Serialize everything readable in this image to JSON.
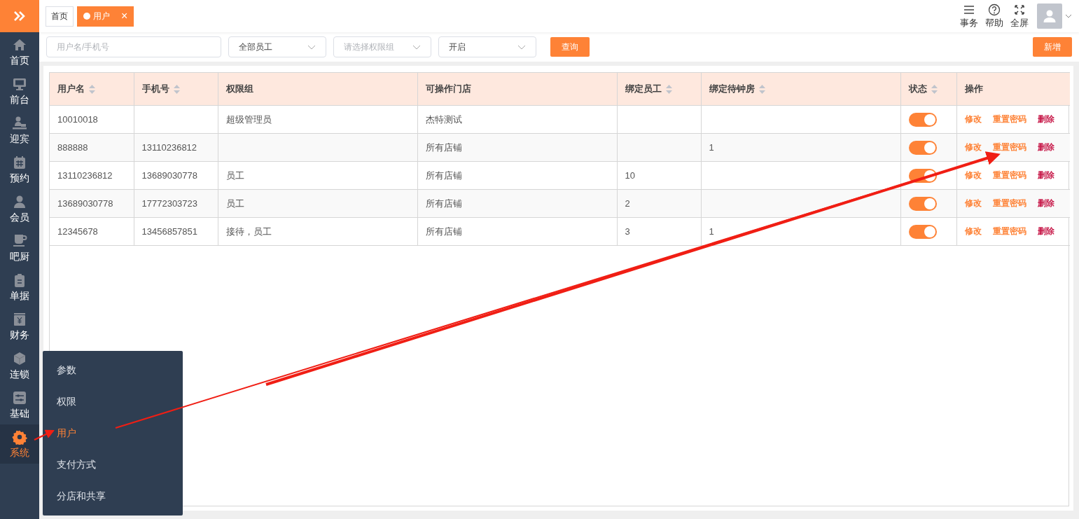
{
  "sidebar": {
    "items": [
      {
        "label": "首页",
        "selected": false
      },
      {
        "label": "前台",
        "selected": false
      },
      {
        "label": "迎宾",
        "selected": false
      },
      {
        "label": "预约",
        "selected": false
      },
      {
        "label": "会员",
        "selected": false
      },
      {
        "label": "吧厨",
        "selected": false
      },
      {
        "label": "单据",
        "selected": false
      },
      {
        "label": "财务",
        "selected": false
      },
      {
        "label": "连锁",
        "selected": false
      },
      {
        "label": "基础",
        "selected": false
      },
      {
        "label": "系统",
        "selected": true
      }
    ]
  },
  "tabs": [
    {
      "label": "首页",
      "selected": false,
      "closable": false
    },
    {
      "label": "用户",
      "selected": true,
      "closable": true
    }
  ],
  "close_glyph": "×",
  "header_actions": [
    {
      "label": "事务"
    },
    {
      "label": "帮助"
    },
    {
      "label": "全屏"
    }
  ],
  "filters": {
    "search": {
      "placeholder": "用户名/手机号"
    },
    "staff": {
      "value": "全部员工"
    },
    "group": {
      "placeholder": "请选择权限组"
    },
    "state": {
      "value": "开启"
    },
    "query_button": "查询",
    "add_button": "新增"
  },
  "table": {
    "columns": [
      {
        "label": "用户名",
        "sortable": true
      },
      {
        "label": "手机号",
        "sortable": true
      },
      {
        "label": "权限组",
        "sortable": false
      },
      {
        "label": "可操作门店",
        "sortable": false
      },
      {
        "label": "绑定员工",
        "sortable": true
      },
      {
        "label": "绑定待钟房",
        "sortable": true
      },
      {
        "label": "状态",
        "sortable": true
      },
      {
        "label": "操作",
        "sortable": false
      }
    ],
    "rows": [
      {
        "cells": [
          "10010018",
          "",
          "超级管理员",
          "杰特测试",
          "",
          ""
        ],
        "on": true,
        "actions": [
          {
            "kind": "edit",
            "label": "修改"
          },
          {
            "kind": "reset",
            "label": "重置密码"
          },
          {
            "kind": "delete",
            "label": "删除"
          }
        ]
      },
      {
        "cells": [
          "888888",
          "13110236812",
          "",
          "所有店铺",
          "",
          "1"
        ],
        "on": true,
        "actions": [
          {
            "kind": "edit",
            "label": "修改"
          },
          {
            "kind": "reset",
            "label": "重置密码"
          },
          {
            "kind": "delete",
            "label": "删除"
          }
        ]
      },
      {
        "cells": [
          "13110236812",
          "13689030778",
          "员工",
          "所有店铺",
          "10",
          ""
        ],
        "on": true,
        "actions": [
          {
            "kind": "edit",
            "label": "修改"
          },
          {
            "kind": "reset",
            "label": "重置密码"
          },
          {
            "kind": "delete",
            "label": "删除"
          }
        ]
      },
      {
        "cells": [
          "13689030778",
          "17772303723",
          "员工",
          "所有店铺",
          "2",
          ""
        ],
        "on": true,
        "actions": [
          {
            "kind": "edit",
            "label": "修改"
          },
          {
            "kind": "reset",
            "label": "重置密码"
          },
          {
            "kind": "delete",
            "label": "删除"
          }
        ]
      },
      {
        "cells": [
          "12345678",
          "13456857851",
          "接待，员工",
          "所有店铺",
          "3",
          "1"
        ],
        "on": true,
        "actions": [
          {
            "kind": "edit",
            "label": "修改"
          },
          {
            "kind": "reset",
            "label": "重置密码"
          },
          {
            "kind": "delete",
            "label": "删除"
          }
        ]
      }
    ]
  },
  "submenu": {
    "items": [
      {
        "label": "参数",
        "selected": false
      },
      {
        "label": "权限",
        "selected": false
      },
      {
        "label": "用户",
        "selected": true
      },
      {
        "label": "支付方式",
        "selected": false
      },
      {
        "label": "分店和共享",
        "selected": false
      }
    ]
  }
}
